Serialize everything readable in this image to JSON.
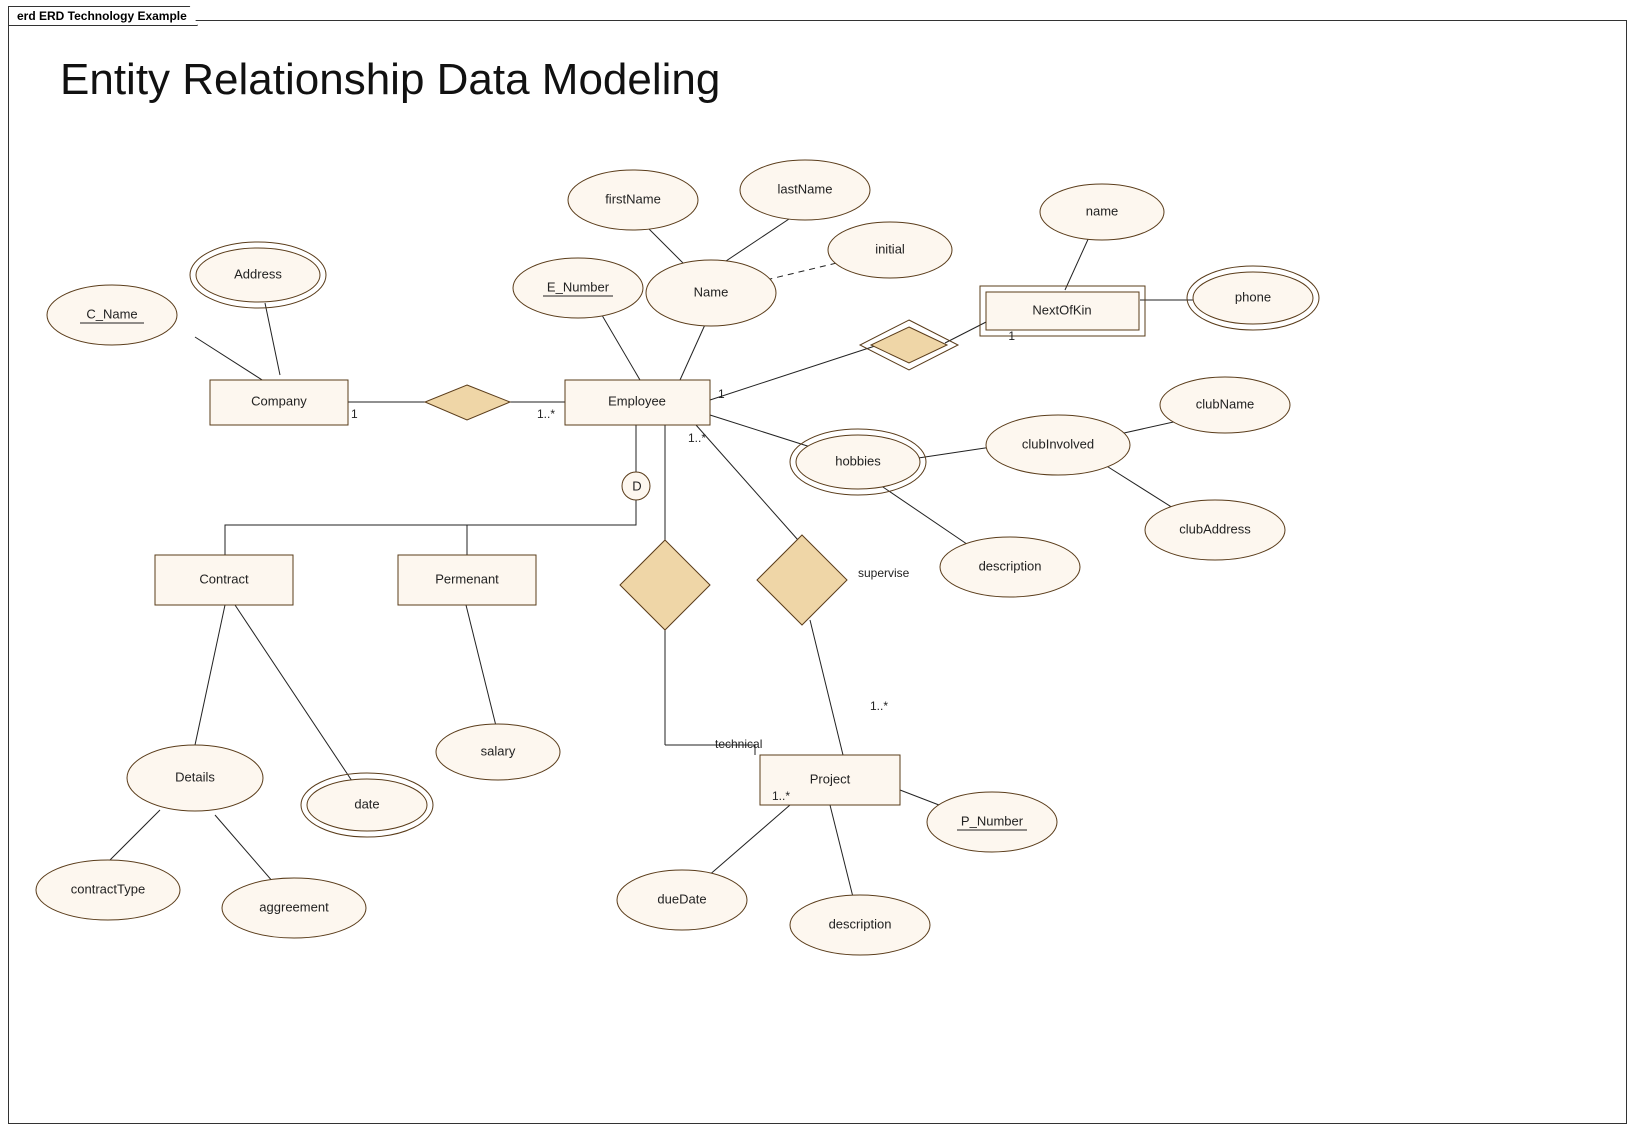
{
  "frame_tab": "erd ERD Technology Example",
  "title": "Entity Relationship Data Modeling",
  "entities": {
    "company": "Company",
    "employee": "Employee",
    "nextofkin": "NextOfKin",
    "contract": "Contract",
    "permenant": "Permenant",
    "project": "Project"
  },
  "attributes": {
    "c_name": "C_Name",
    "address": "Address",
    "e_number": "E_Number",
    "name_comp": "Name",
    "firstName": "firstName",
    "lastName": "lastName",
    "initial": "initial",
    "hobbies": "hobbies",
    "clubInvolved": "clubInvolved",
    "clubName": "clubName",
    "clubAddress": "clubAddress",
    "description_hobby": "description",
    "nok_name": "name",
    "nok_phone": "phone",
    "details": "Details",
    "contractType": "contractType",
    "date": "date",
    "aggreement": "aggreement",
    "salary": "salary",
    "p_number": "P_Number",
    "dueDate": "dueDate",
    "description_proj": "description"
  },
  "relationships": {
    "supervise": "supervise",
    "technical": "technical"
  },
  "cardinalities": {
    "company_side": "1",
    "employee_from_company": "1..*",
    "employee_to_nok": "1",
    "nok_side": "1",
    "employee_to_projects": "1..*",
    "project_supervise": "1..*",
    "project_technical": "1..*"
  },
  "disjoint": "D"
}
